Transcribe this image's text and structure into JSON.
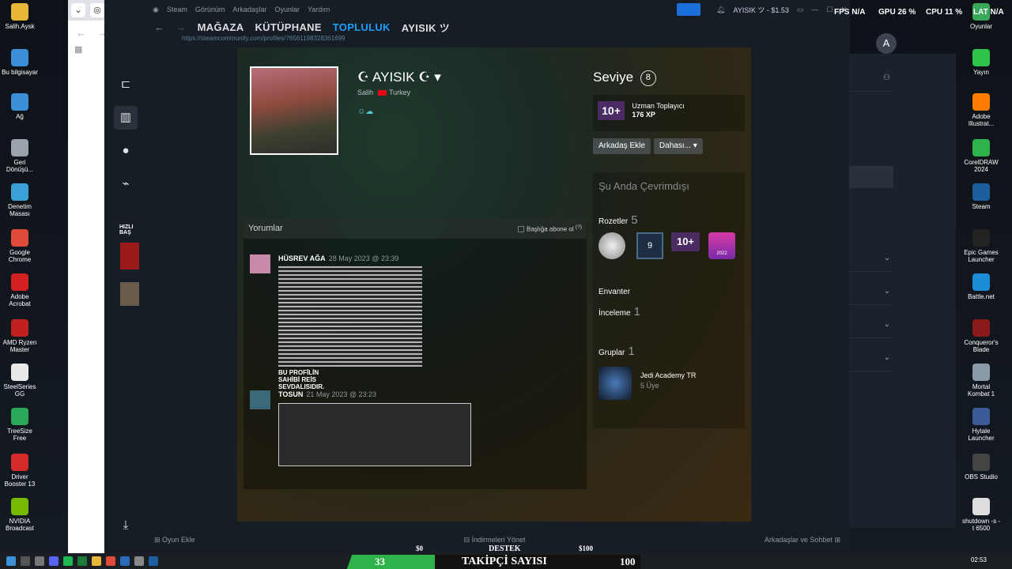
{
  "desktop_left": [
    {
      "label": "Salih.Aysk",
      "color": "#e8b73a"
    },
    {
      "label": "Bu bilgisayar",
      "color": "#3a8fd6"
    },
    {
      "label": "Ağ",
      "color": "#3a8fd6"
    },
    {
      "label": "Geri Dönüşü...",
      "color": "#9aa3ab"
    },
    {
      "label": "Denetim Masası",
      "color": "#3aa0d6"
    },
    {
      "label": "Google Chrome",
      "color": "#e04a3a"
    },
    {
      "label": "Adobe Acrobat",
      "color": "#d32020"
    },
    {
      "label": "AMD Ryzen Master",
      "color": "#c02020"
    },
    {
      "label": "SteelSeries GG",
      "color": "#e8e8e8"
    },
    {
      "label": "TreeSize Free",
      "color": "#2aa85a"
    },
    {
      "label": "Driver Booster 13",
      "color": "#d42a2a"
    },
    {
      "label": "NVIDIA Broadcast",
      "color": "#76b900"
    }
  ],
  "desktop_right": [
    {
      "label": "Oyunlar",
      "color": "#3aa85a"
    },
    {
      "label": "Yayın",
      "color": "#2ec24a"
    },
    {
      "label": "Adobe Illustrat...",
      "color": "#ff7c00"
    },
    {
      "label": "CorelDRAW 2024",
      "color": "#2db34a"
    },
    {
      "label": "Steam",
      "color": "#1b5f9e"
    },
    {
      "label": "Epic Games Launcher",
      "color": "#222222"
    },
    {
      "label": "Battle.net",
      "color": "#1a8cd8"
    },
    {
      "label": "Conqueror's Blade",
      "color": "#8a1a1a"
    },
    {
      "label": "Mortal Kombat 1",
      "color": "#8a9aa8"
    },
    {
      "label": "Hytale Launcher",
      "color": "#3a5a9a"
    },
    {
      "label": "OBS Studio",
      "color": "#444444"
    },
    {
      "label": "shutdown -s -t 6500",
      "color": "#dddddd"
    }
  ],
  "steam": {
    "menu": [
      "Steam",
      "Görünüm",
      "Arkadaşlar",
      "Oyunlar",
      "Yardım"
    ],
    "account": "AYISIK ツ - $1.53",
    "nav": [
      "MAĞAZA",
      "KÜTÜPHANE",
      "TOPLULUK",
      "AYISIK ツ"
    ],
    "url": "https://steamcommunity.com/profiles/76561198328361699",
    "quick_access": "HIZLI BAŞ",
    "bottom": {
      "add_game": "Oyun Ekle",
      "downloads": "İndirmeleri Yönet",
      "friends": "Arkadaşlar ve Sohbet"
    }
  },
  "profile": {
    "name": "☪ AYISIK ☪",
    "real_name": "Salih",
    "country": "Turkey",
    "level_label": "Seviye",
    "level": "8",
    "badge_text": "10+",
    "xp_title": "Uzman Toplayıcı",
    "xp": "176 XP",
    "add_friend": "Arkadaş Ekle",
    "more": "Dahası... ▾",
    "status": "Şu Anda Çevrimdışı",
    "badges_label": "Rozetler",
    "badges_count": "5",
    "inventory": "Envanter",
    "reviews_label": "İnceleme",
    "reviews_count": "1",
    "groups_label": "Gruplar",
    "groups_count": "1",
    "group_name": "Jedi Academy TR",
    "group_members": "5 Üye",
    "badge_9": "9",
    "badge_2022": "2022"
  },
  "comments": {
    "title": "Yorumlar",
    "subscribe": "Başlığa abone ol",
    "items": [
      {
        "user": "HÜSREV AĞA",
        "date": "28 May 2023 @ 23:39",
        "text": "BU PROFİLİN SAHİBİ REİS SEVDALISIDIR."
      },
      {
        "user": "TOSUN",
        "date": "21 May 2023 @ 23:23"
      }
    ]
  },
  "overlay": {
    "fps": "FPS N/A",
    "gpu": "GPU 26 %",
    "cpu": "CPU 11 %",
    "lat": "LAT N/A"
  },
  "stream": {
    "low": "$0",
    "label": "DESTEK",
    "high": "$100",
    "followers": "33",
    "followers_label": "TAKİPÇİ SAYISI",
    "goal": "100"
  },
  "clock": "02:53"
}
